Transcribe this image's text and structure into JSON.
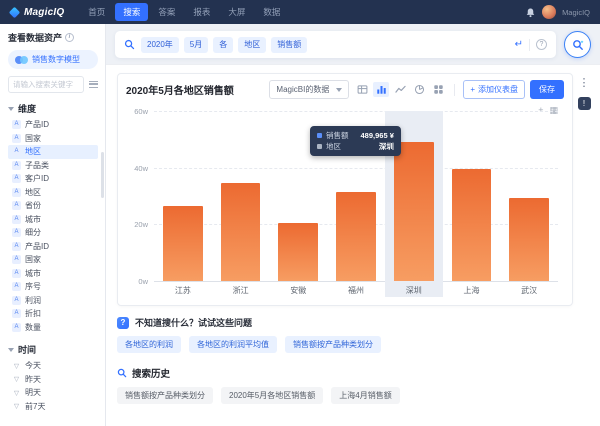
{
  "topbar": {
    "logo": "MagicIQ",
    "nav": [
      {
        "label": "首页"
      },
      {
        "label": "搜索",
        "active": true
      },
      {
        "label": "答案"
      },
      {
        "label": "报表"
      },
      {
        "label": "大屏"
      },
      {
        "label": "数据"
      }
    ],
    "username": "MagicIQ"
  },
  "sidebar": {
    "title": "查看数据资产",
    "model": "销售数字模型",
    "search_placeholder": "请输入搜索关键字",
    "dimension_section": "维度",
    "dimension_items": [
      {
        "label": "产品ID"
      },
      {
        "label": "国家"
      },
      {
        "label": "地区",
        "active": true
      },
      {
        "label": "子品类"
      },
      {
        "label": "客户ID"
      },
      {
        "label": "地区"
      },
      {
        "label": "省份"
      },
      {
        "label": "城市"
      },
      {
        "label": "细分"
      },
      {
        "label": "产品ID"
      },
      {
        "label": "国家"
      },
      {
        "label": "城市"
      },
      {
        "label": "序号"
      },
      {
        "label": "利润"
      },
      {
        "label": "折扣"
      },
      {
        "label": "数量"
      }
    ],
    "time_section": "时间",
    "time_items": [
      {
        "label": "今天"
      },
      {
        "label": "昨天"
      },
      {
        "label": "明天"
      },
      {
        "label": "前7天"
      }
    ]
  },
  "search": {
    "tokens": [
      "2020年",
      "5月",
      "各",
      "地区",
      "销售额"
    ]
  },
  "card": {
    "title": "2020年5月各地区销售额",
    "datasource": "MagicBI的数据",
    "add_dashboard": "添加仪表盘",
    "save": "保存"
  },
  "chart_data": {
    "type": "bar",
    "title": "2020年5月各地区销售额",
    "categories": [
      "江苏",
      "浙江",
      "安徽",
      "福州",
      "深圳",
      "上海",
      "武汉"
    ],
    "values": [
      265000,
      345000,
      205000,
      315000,
      489965,
      396000,
      292000
    ],
    "unit": "¥",
    "ylim": [
      0,
      600000
    ],
    "ytick_labels": [
      "0w",
      "20w",
      "40w",
      "60w"
    ],
    "grid": "dashed-horizontal",
    "highlight_index": 4,
    "bar_color_top": "#ec6a31",
    "bar_color_bottom": "#f79d62",
    "highlight_band_color": "#e9edf4",
    "tooltip": {
      "rows": [
        {
          "label": "销售额",
          "value": "489,965 ¥",
          "color": "#5b8ff9"
        },
        {
          "label": "地区",
          "value": "深圳",
          "color": "#aab4c3"
        }
      ]
    }
  },
  "suggest": {
    "hint": "不知道搜什么？试试这些问题",
    "chips": [
      "各地区的利润",
      "各地区的利润平均值",
      "销售额按产品种类划分"
    ],
    "history_title": "搜索历史",
    "history_chips": [
      "销售额按产品种类划分",
      "2020年5月各地区销售额",
      "上海4月销售额"
    ]
  },
  "icons": {
    "field_glyph": "A",
    "filter_glyph": "▽",
    "enter_glyph": "↵",
    "info_glyph": "i",
    "question_glyph": "?",
    "more_vertical_glyph": "⋮",
    "feedback_glyph": "!",
    "hint_glyph": "?",
    "plus_glyph": "+",
    "toolbox_plus_glyph": "+",
    "toolbox_grid_glyph": "▦"
  }
}
